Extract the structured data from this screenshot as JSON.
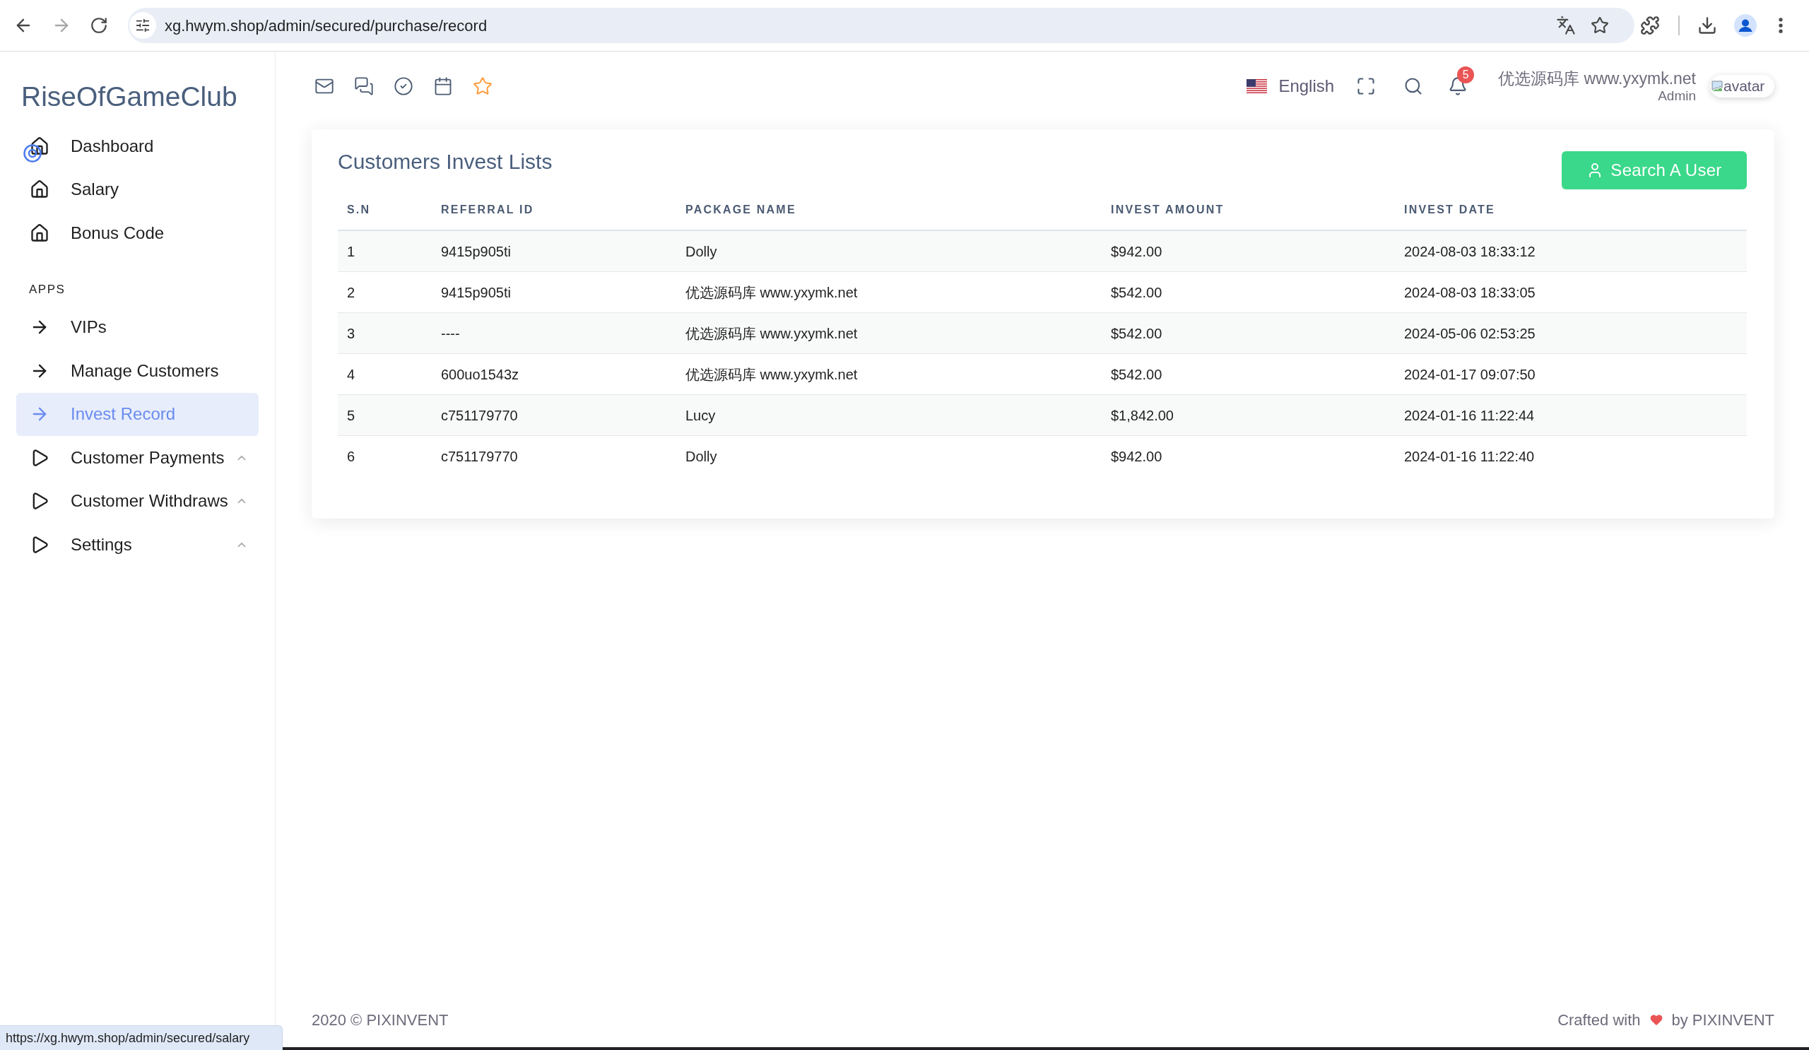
{
  "browser": {
    "url": "xg.hwym.shop/admin/secured/purchase/record",
    "status_url": "https://xg.hwym.shop/admin/secured/salary"
  },
  "sidebar": {
    "brand": "RiseOfGameClub",
    "items": [
      {
        "label": "Dashboard",
        "kind": "home",
        "selected": false,
        "focused": true
      },
      {
        "label": "Salary",
        "kind": "home",
        "selected": false,
        "focused": false
      },
      {
        "label": "Bonus Code",
        "kind": "home",
        "selected": false,
        "focused": false
      }
    ],
    "section": {
      "label": "APPS",
      "items": [
        {
          "label": "VIPs",
          "kind": "link",
          "selected": false
        },
        {
          "label": "Manage Customers",
          "kind": "link",
          "selected": false
        },
        {
          "label": "Invest Record",
          "kind": "link",
          "selected": true
        },
        {
          "label": "Customer Payments",
          "kind": "group",
          "selected": false
        },
        {
          "label": "Customer Withdraws",
          "kind": "group",
          "selected": false
        },
        {
          "label": "Settings",
          "kind": "group",
          "selected": false
        }
      ]
    }
  },
  "header": {
    "language": "English",
    "notification_count": "5",
    "user": {
      "name": "优选源码库 www.yxymk.net",
      "role": "Admin",
      "avatar_alt": "avatar"
    }
  },
  "card": {
    "title": "Customers Invest Lists",
    "button": "Search A User",
    "table": {
      "columns": [
        "S.N",
        "REFERRAL ID",
        "PACKAGE NAME",
        "INVEST AMOUNT",
        "INVEST DATE"
      ],
      "rows": [
        [
          "1",
          "9415p905ti",
          "Dolly",
          "$942.00",
          "2024-08-03 18:33:12"
        ],
        [
          "2",
          "9415p905ti",
          "优选源码库 www.yxymk.net",
          "$542.00",
          "2024-08-03 18:33:05"
        ],
        [
          "3",
          "----",
          "优选源码库 www.yxymk.net",
          "$542.00",
          "2024-05-06 02:53:25"
        ],
        [
          "4",
          "600uo1543z",
          "优选源码库 www.yxymk.net",
          "$542.00",
          "2024-01-17 09:07:50"
        ],
        [
          "5",
          "c751179770",
          "Lucy",
          "$1,842.00",
          "2024-01-16 11:22:44"
        ],
        [
          "6",
          "c751179770",
          "Dolly",
          "$942.00",
          "2024-01-16 11:22:40"
        ]
      ]
    }
  },
  "footer": {
    "copyright": "2020 © PIXINVENT",
    "credit_before": "Crafted with",
    "credit_after": "by PIXINVENT"
  }
}
